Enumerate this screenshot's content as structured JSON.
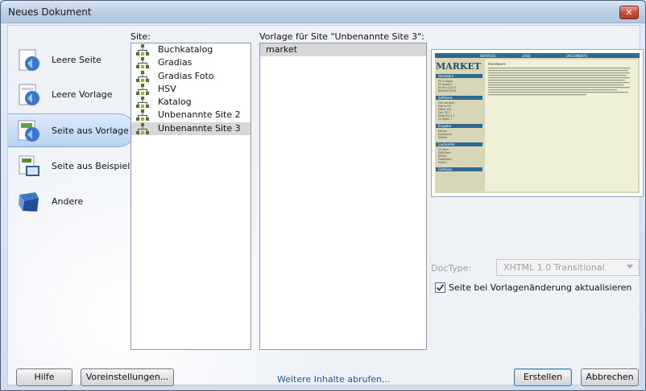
{
  "window": {
    "title": "Neues Dokument",
    "close_label": "✕"
  },
  "categories": [
    {
      "label": "Leere Seite",
      "icon": "blank-page-icon",
      "selected": false
    },
    {
      "label": "Leere Vorlage",
      "icon": "blank-template-icon",
      "selected": false
    },
    {
      "label": "Seite aus Vorlage",
      "icon": "page-from-template-icon",
      "selected": true
    },
    {
      "label": "Seite aus Beispiel",
      "icon": "page-from-sample-icon",
      "selected": false
    },
    {
      "label": "Andere",
      "icon": "other-icon",
      "selected": false
    }
  ],
  "site": {
    "label": "Site:",
    "items": [
      "Buchkatalog",
      "Gradias",
      "Gradias Foto",
      "HSV",
      "Katalog",
      "Unbenannte Site 2",
      "Unbenannte Site 3"
    ],
    "selected": "Unbenannte Site 3"
  },
  "template": {
    "label": "Vorlage für Site \"Unbenannte Site 3\":",
    "items": [
      "market"
    ],
    "selected": "market"
  },
  "preview": {
    "nav": [
      "SERVICES",
      "CASE",
      "DOCUMENTS"
    ],
    "brand": "MARKET",
    "heading": "Hardware",
    "sidebar_groups": [
      {
        "title": "Hardware",
        "items": [
          "PC & Apple",
          "PC Arbeit 1",
          "All PCs 1/2a 3",
          "Bärentiz 5/2/3"
        ]
      },
      {
        "title": "Software",
        "items": [
          "Hier sie dern",
          "Sterns 4.0",
          "Office 10a",
          "Calc 33.1",
          "Wrap Pro 2.3",
          "Cv Mittal 1"
        ]
      },
      {
        "title": "Eingabe",
        "items": [
          "Mäuse",
          "Keyboards",
          "Tablets"
        ]
      },
      {
        "title": "Laufwerke",
        "items": [
          "CD-Rom",
          "DVD-Rom",
          "Wüller",
          "Postkoffen",
          "Extern"
        ]
      },
      {
        "title": "Gehäuse",
        "items": []
      }
    ]
  },
  "doctype": {
    "label": "DocType:",
    "value": "XHTML 1.0 Transitional"
  },
  "update_checkbox": {
    "label": "Seite bei Vorlagenänderung aktualisieren",
    "checked": true
  },
  "footer": {
    "help": "Hilfe",
    "preferences": "Voreinstellungen...",
    "more_link": "Weitere Inhalte abrufen...",
    "create": "Erstellen",
    "cancel": "Abbrechen"
  }
}
